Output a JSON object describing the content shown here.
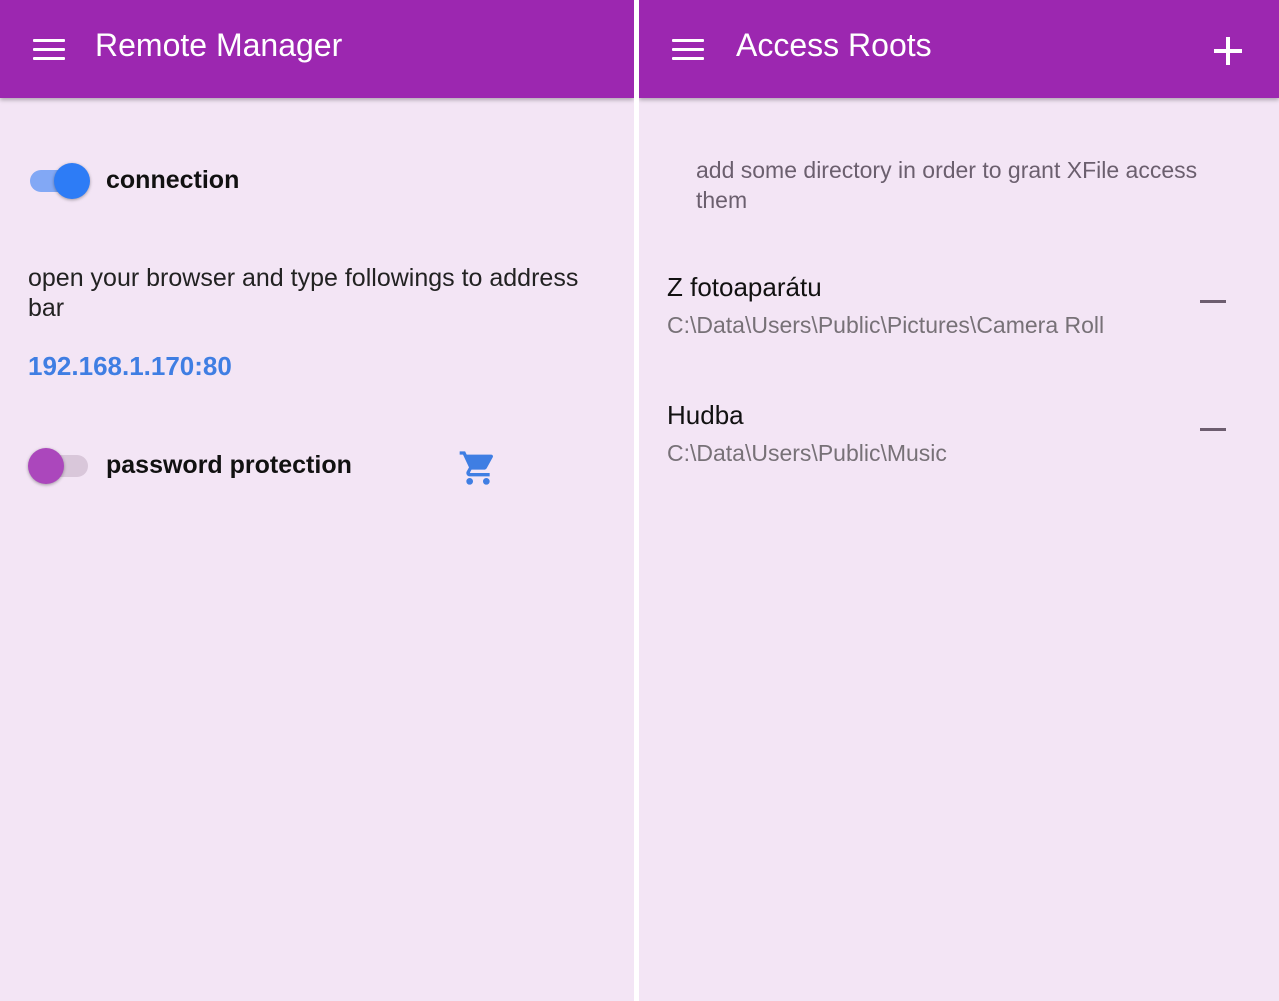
{
  "remote_manager": {
    "title": "Remote Manager",
    "connection": {
      "label": "connection",
      "enabled": true
    },
    "instructions": "open your browser and type followings to address bar",
    "address": "192.168.1.170:80",
    "password_protection": {
      "label": "password protection",
      "enabled": false
    }
  },
  "access_roots": {
    "title": "Access Roots",
    "hint": "add some directory in order to grant XFile access them",
    "roots": [
      {
        "name": "Z fotoaparátu",
        "path": "C:\\Data\\Users\\Public\\Pictures\\Camera Roll"
      },
      {
        "name": "Hudba",
        "path": "C:\\Data\\Users\\Public\\Music"
      }
    ]
  },
  "colors": {
    "appbar": "#9c27b0",
    "background": "#f3e5f5",
    "accent_blue": "#2d7cf6",
    "link_blue": "#3f7ee3",
    "switch_off_thumb": "#ab47bc"
  },
  "icons": {
    "menu": "menu-icon",
    "add": "plus-icon",
    "remove": "minus-icon",
    "store": "shopping-cart-icon"
  }
}
